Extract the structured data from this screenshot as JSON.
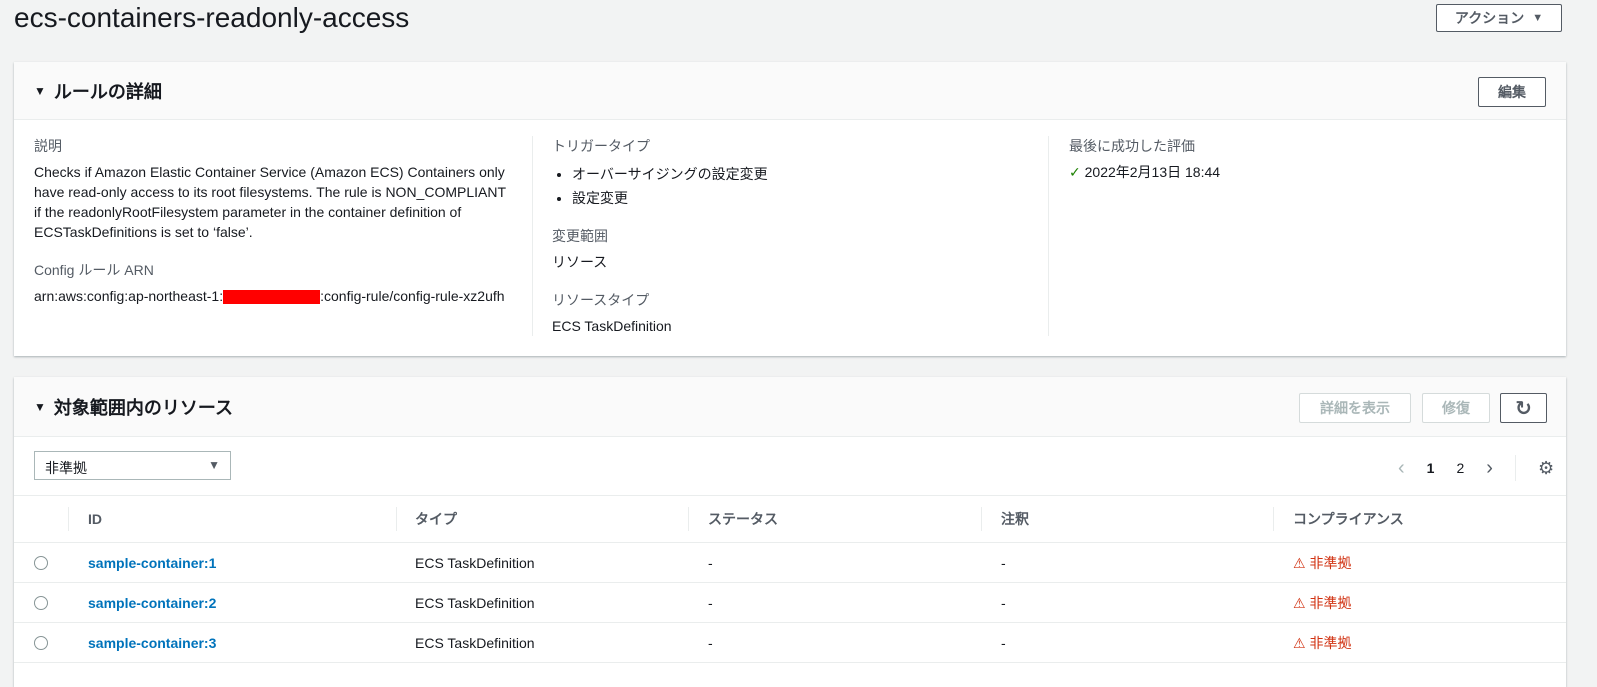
{
  "title": "ecs-containers-readonly-access",
  "actions_label": "アクション",
  "details": {
    "heading": "ルールの詳細",
    "edit_label": "編集",
    "description_label": "説明",
    "description": "Checks if Amazon Elastic Container Service (Amazon ECS) Containers only have read-only access to its root filesystems. The rule is NON_COMPLIANT if the readonlyRootFilesystem parameter in the container definition of ECSTaskDefinitions is set to ‘false’.",
    "arn_label": "Config ルール ARN",
    "arn_prefix": "arn:aws:config:ap-northeast-1:",
    "arn_suffix": ":config-rule/config-rule-xz2ufh",
    "trigger_label": "トリガータイプ",
    "triggers": [
      "オーバーサイジングの設定変更",
      "設定変更"
    ],
    "scope_label": "変更範囲",
    "scope": "リソース",
    "resource_type_label": "リソースタイプ",
    "resource_type": "ECS TaskDefinition",
    "last_eval_label": "最後に成功した評価",
    "last_eval": "2022年2月13日 18:44"
  },
  "resources": {
    "heading": "対象範囲内のリソース",
    "view_details_label": "詳細を表示",
    "remediate_label": "修復",
    "filter_value": "非準拠",
    "pages": [
      "1",
      "2"
    ],
    "columns": [
      "ID",
      "タイプ",
      "ステータス",
      "注釈",
      "コンプライアンス"
    ],
    "rows": [
      {
        "id": "sample-container:1",
        "type": "ECS TaskDefinition",
        "status": "-",
        "annotation": "-",
        "compliance": "非準拠"
      },
      {
        "id": "sample-container:2",
        "type": "ECS TaskDefinition",
        "status": "-",
        "annotation": "-",
        "compliance": "非準拠"
      },
      {
        "id": "sample-container:3",
        "type": "ECS TaskDefinition",
        "status": "-",
        "annotation": "-",
        "compliance": "非準拠"
      }
    ]
  },
  "colors": {
    "link": "#0073bb",
    "noncompliant": "#d13212",
    "success": "#1d8102"
  }
}
